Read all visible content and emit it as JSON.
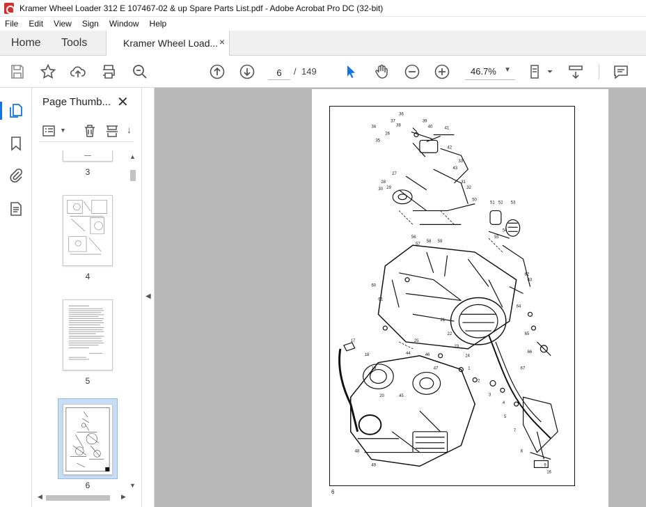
{
  "window": {
    "title": "Kramer Wheel Loader 312 E 107467-02 & up Spare Parts List.pdf - Adobe Acrobat Pro DC (32-bit)"
  },
  "menu": [
    "File",
    "Edit",
    "View",
    "Sign",
    "Window",
    "Help"
  ],
  "tabs": {
    "home": "Home",
    "tools": "Tools",
    "document": "Kramer Wheel Load...",
    "close_glyph": "×"
  },
  "toolbar": {
    "current_page": "6",
    "separator": "/",
    "total_pages": "149",
    "zoom": "46.7%"
  },
  "panel": {
    "title": "Page Thumb...",
    "thumbnails": [
      {
        "label": "3"
      },
      {
        "label": "4"
      },
      {
        "label": "5"
      },
      {
        "label": "6",
        "selected": true
      }
    ]
  },
  "document": {
    "page_number": "6",
    "callouts": [
      "36",
      "37",
      "38",
      "39",
      "40",
      "41",
      "42",
      "43",
      "33",
      "34",
      "35",
      "26",
      "27",
      "28",
      "29",
      "30",
      "31",
      "32",
      "50",
      "51",
      "52",
      "53",
      "54",
      "55",
      "56",
      "57",
      "58",
      "59",
      "60",
      "61",
      "62",
      "63",
      "64",
      "65",
      "66",
      "67",
      "1",
      "2",
      "3",
      "4",
      "5",
      "7",
      "8",
      "9",
      "16",
      "17",
      "18",
      "19",
      "20",
      "21",
      "22",
      "23",
      "24",
      "25",
      "44",
      "45",
      "46",
      "47",
      "48",
      "49"
    ]
  },
  "colors": {
    "accent": "#1473e6",
    "selected_thumb": "#c7def4",
    "doc_background": "#b8b8b8"
  }
}
